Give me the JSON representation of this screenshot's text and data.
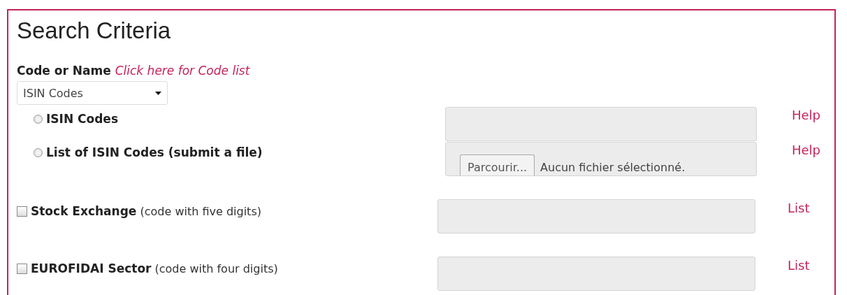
{
  "title": "Search Criteria",
  "code_label": {
    "label": "Code or Name",
    "link": "Click here for Code list"
  },
  "dropdown": {
    "value": "ISIN Codes"
  },
  "rows": [
    {
      "kind": "radio",
      "label": "ISIN Codes",
      "selected": false,
      "link": "Help"
    },
    {
      "kind": "file",
      "label": "List of ISIN Codes (submit a file)",
      "selected": false,
      "button": "Parcourir...",
      "status": "Aucun fichier sélectionné.",
      "link": "Help"
    },
    {
      "kind": "checkbox",
      "label": "**Stock Exchange** (code with five digits)",
      "checked": false,
      "link": "List"
    },
    {
      "kind": "checkbox",
      "label": "**EUROFIDAI Sector** (code with four digits)",
      "checked": false,
      "link": "List"
    }
  ]
}
